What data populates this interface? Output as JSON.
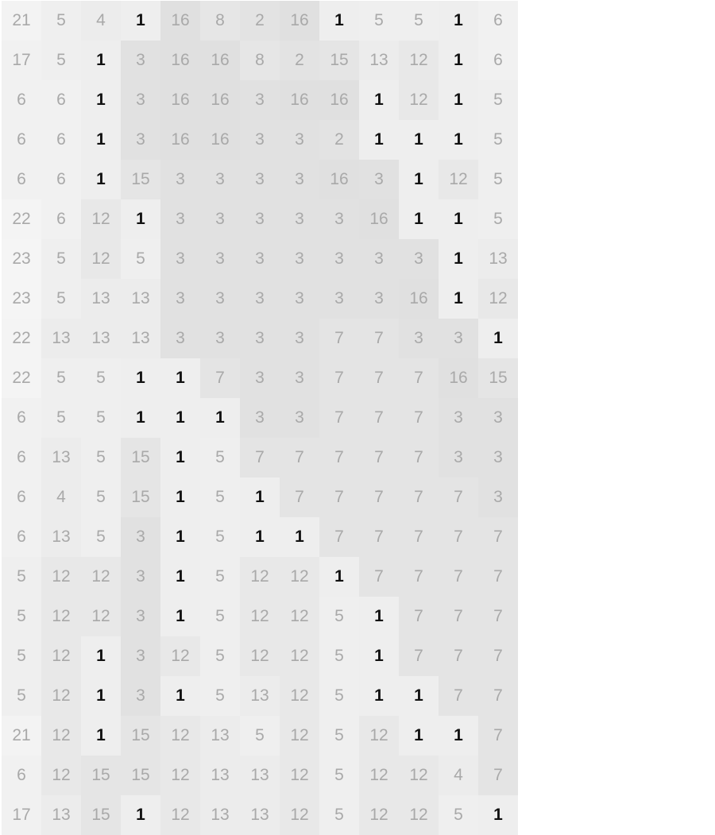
{
  "grid": {
    "rows": [
      [
        "21",
        "5",
        "4",
        "1",
        "16",
        "8",
        "2",
        "16",
        "1",
        "5",
        "5",
        "1",
        "6"
      ],
      [
        "17",
        "5",
        "1",
        "3",
        "16",
        "16",
        "8",
        "2",
        "15",
        "13",
        "12",
        "1",
        "6"
      ],
      [
        "6",
        "6",
        "1",
        "3",
        "16",
        "16",
        "3",
        "16",
        "16",
        "1",
        "12",
        "1",
        "5"
      ],
      [
        "6",
        "6",
        "1",
        "3",
        "16",
        "16",
        "3",
        "3",
        "2",
        "1",
        "1",
        "1",
        "5"
      ],
      [
        "6",
        "6",
        "1",
        "15",
        "3",
        "3",
        "3",
        "3",
        "16",
        "3",
        "1",
        "12",
        "5"
      ],
      [
        "22",
        "6",
        "12",
        "1",
        "3",
        "3",
        "3",
        "3",
        "3",
        "16",
        "1",
        "1",
        "5"
      ],
      [
        "23",
        "5",
        "12",
        "5",
        "3",
        "3",
        "3",
        "3",
        "3",
        "3",
        "3",
        "1",
        "13"
      ],
      [
        "23",
        "5",
        "13",
        "13",
        "3",
        "3",
        "3",
        "3",
        "3",
        "3",
        "16",
        "1",
        "12"
      ],
      [
        "22",
        "13",
        "13",
        "13",
        "3",
        "3",
        "3",
        "3",
        "7",
        "7",
        "3",
        "3",
        "1"
      ],
      [
        "22",
        "5",
        "5",
        "1",
        "1",
        "7",
        "3",
        "3",
        "7",
        "7",
        "7",
        "16",
        "15"
      ],
      [
        "6",
        "5",
        "5",
        "1",
        "1",
        "1",
        "3",
        "3",
        "7",
        "7",
        "7",
        "3",
        "3"
      ],
      [
        "6",
        "13",
        "5",
        "15",
        "1",
        "5",
        "7",
        "7",
        "7",
        "7",
        "7",
        "3",
        "3"
      ],
      [
        "6",
        "4",
        "5",
        "15",
        "1",
        "5",
        "1",
        "7",
        "7",
        "7",
        "7",
        "7",
        "3"
      ],
      [
        "6",
        "13",
        "5",
        "3",
        "1",
        "5",
        "1",
        "1",
        "7",
        "7",
        "7",
        "7",
        "7"
      ],
      [
        "5",
        "12",
        "12",
        "3",
        "1",
        "5",
        "12",
        "12",
        "1",
        "7",
        "7",
        "7",
        "7"
      ],
      [
        "5",
        "12",
        "12",
        "3",
        "1",
        "5",
        "12",
        "12",
        "5",
        "1",
        "7",
        "7",
        "7"
      ],
      [
        "5",
        "12",
        "1",
        "3",
        "12",
        "5",
        "12",
        "12",
        "5",
        "1",
        "7",
        "7",
        "7"
      ],
      [
        "5",
        "12",
        "1",
        "3",
        "1",
        "5",
        "13",
        "12",
        "5",
        "1",
        "1",
        "7",
        "7"
      ],
      [
        "21",
        "12",
        "1",
        "15",
        "12",
        "13",
        "5",
        "12",
        "5",
        "12",
        "1",
        "1",
        "7"
      ],
      [
        "6",
        "12",
        "15",
        "15",
        "12",
        "13",
        "13",
        "12",
        "5",
        "12",
        "12",
        "4",
        "7"
      ],
      [
        "17",
        "13",
        "15",
        "1",
        "12",
        "13",
        "13",
        "12",
        "5",
        "12",
        "12",
        "5",
        "1"
      ]
    ],
    "colors": {
      "1": "#eeeeee",
      "2": "#e3e3e3",
      "3": "#e1e1e1",
      "4": "#ececec",
      "5": "#efefef",
      "6": "#f1f1f1",
      "7": "#e4e4e4",
      "8": "#e6e6e6",
      "12": "#e8e8e8",
      "13": "#ececec",
      "15": "#e5e5e5",
      "16": "#e0e0e0",
      "17": "#f1f1f1",
      "21": "#f3f3f3",
      "22": "#f4f4f4",
      "23": "#f5f5f5"
    },
    "highlight_value": "1"
  }
}
